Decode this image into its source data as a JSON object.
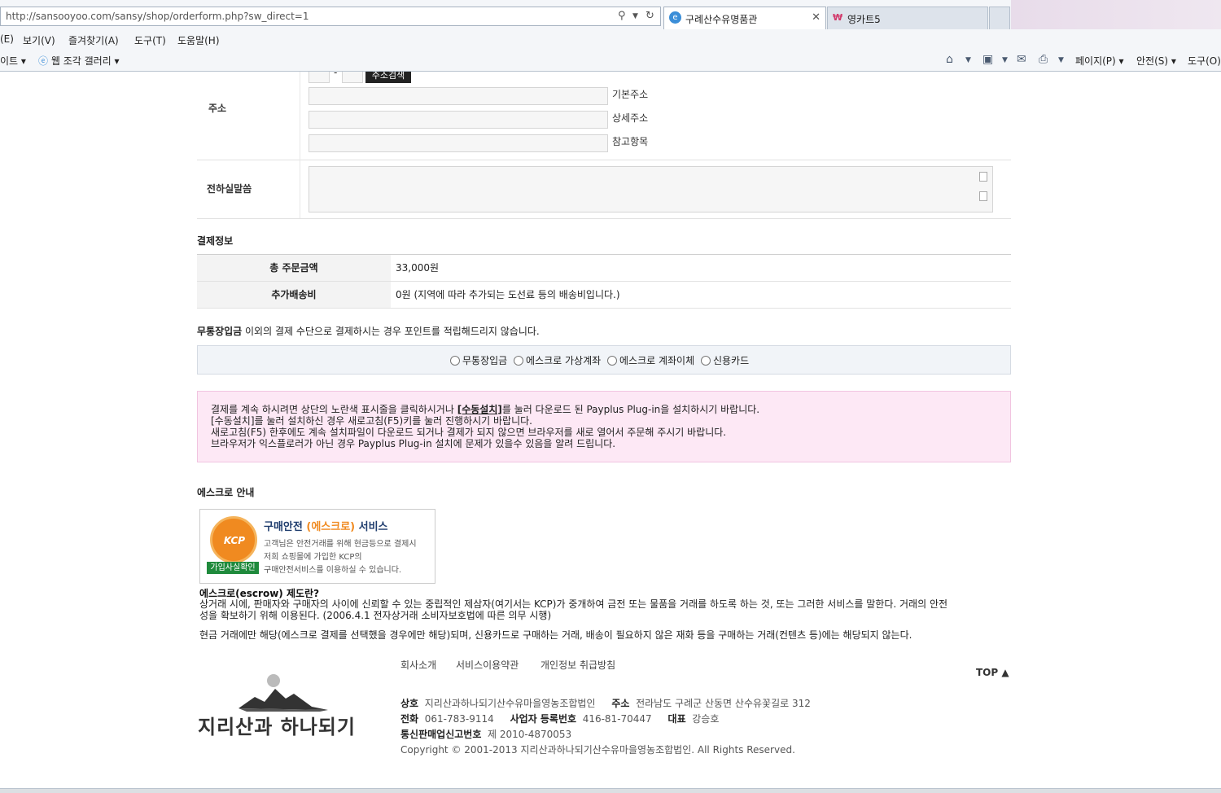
{
  "browser": {
    "url": "http://sansooyoo.com/sansy/shop/orderform.php?sw_direct=1",
    "tab_active": "구례산수유명품관",
    "tab_second": "영카트5",
    "menu": [
      "(E)",
      "보기(V)",
      "즐겨찾기(A)",
      "도구(T)",
      "도움말(H)"
    ],
    "fav_site": "이트",
    "fav_gallery": "웹 조각 갤러리",
    "toolbar": [
      "페이지(P)",
      "안전(S)",
      "도구(O)"
    ]
  },
  "address": {
    "label": "주소",
    "zip_button": "주소검색",
    "base_label": "기본주소",
    "detail_label": "상세주소",
    "ref_label": "참고항목"
  },
  "message": {
    "label": "전하실말씀"
  },
  "payment": {
    "title": "결제정보",
    "total_label": "총 주문금액",
    "total_value": "33,000원",
    "extra_label": "추가배송비",
    "extra_value": "0원 (지역에 따라 추가되는 도선료 등의 배송비입니다.)",
    "notice_bold": "무통장입금",
    "notice_rest": " 이외의 결제 수단으로 결제하시는 경우 포인트를 적립해드리지 않습니다.",
    "methods": [
      "무통장입금",
      "에스크로 가상계좌",
      "에스크로 계좌이체",
      "신용카드"
    ]
  },
  "plugin": {
    "line1_a": "결제를 계속 하시려면 상단의 노란색 표시줄을 클릭하시거나 ",
    "line1_link": "[수동설치]",
    "line1_b": "를 눌러 다운로드 된 Payplus Plug-in을 설치하시기 바랍니다.",
    "line2": "[수동설치]를 눌러 설치하신 경우 새로고침(F5)키를 눌러 진행하시기 바랍니다.",
    "line3": "새로고침(F5) 한후에도 계속 설치파일이 다운로드 되거나 결제가 되지 않으면 브라우저를 새로 열어서 주문해 주시기 바랍니다.",
    "line4": "브라우저가 익스플로러가 아닌 경우 Payplus Plug-in 설치에 문제가 있을수 있음을 알려 드립니다."
  },
  "escrow": {
    "title": "에스크로 안내",
    "card_title_a": "구매안전 ",
    "card_title_b": "(에스크로)",
    "card_title_c": " 서비스",
    "card_desc1": "고객님은 안전거래를 위해 현금등으로 결제시",
    "card_desc2": "저희 쇼핑몰에 가입한 KCP의",
    "card_desc3": "구매안전서비스를 이용하실 수 있습니다.",
    "kcp": "KCP",
    "badge": "가입사실확인 ▶",
    "question": "에스크로(escrow) 제도란?",
    "p1": "상거래 시에, 판매자와 구매자의 사이에 신뢰할 수 있는 중립적인 제삼자(여기서는 KCP)가 중개하여 금전 또는 물품을 거래를 하도록 하는 것, 또는 그러한 서비스를 말한다. 거래의 안전",
    "p2": "성을 확보하기 위해 이용된다. (2006.4.1 전자상거래 소비자보호법에 따른 의무 시행)",
    "p3": "현금 거래에만 해당(에스크로 결제를 선택했을 경우에만 해당)되며, 신용카드로 구매하는 거래, 배송이 필요하지 않은 재화 등을 구매하는 거래(컨텐츠 등)에는 해당되지 않는다."
  },
  "footer": {
    "links": [
      "회사소개",
      "서비스이용약관",
      "개인정보 취급방침"
    ],
    "top": "TOP ▲",
    "logo_text": "지리산과 하나되기",
    "company_label": "상호",
    "company": "지리산과하나되기산수유마을영농조합법인",
    "addr_label": "주소",
    "addr": "전라남도 구례군 산동면 산수유꽃길로 312",
    "tel_label": "전화",
    "tel": "061-783-9114",
    "biz_label": "사업자 등록번호",
    "biz": "416-81-70447",
    "ceo_label": "대표",
    "ceo": "강승호",
    "mail_label": "통신판매업신고번호",
    "mail": "제 2010-4870053",
    "copyright": "Copyright © 2001-2013 지리산과하나되기산수유마을영농조합법인. All Rights Reserved."
  }
}
